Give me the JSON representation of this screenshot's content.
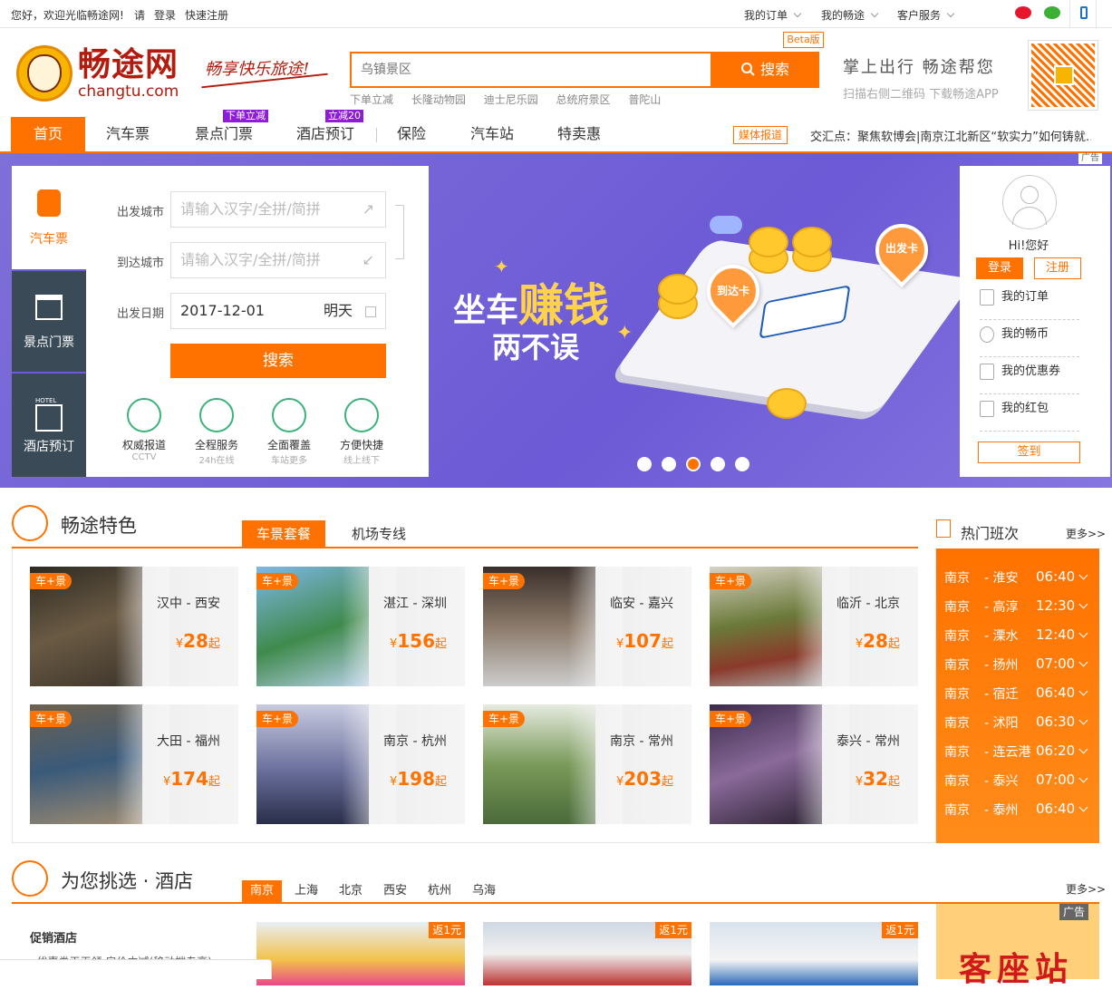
{
  "topbar": {
    "greeting": "您好，欢迎光临畅途网!",
    "please": "请",
    "login": "登录",
    "register": "快速注册",
    "my_orders": "我的订单",
    "my_changtu": "我的畅途",
    "service": "客户服务"
  },
  "header": {
    "logo_cn": "畅途网",
    "logo_en": "changtu.com",
    "slogan": "畅享快乐旅途!",
    "search_placeholder": "乌镇景区",
    "search_button": "搜索",
    "beta": "Beta版",
    "hot_words": [
      "下单立减",
      "长隆动物园",
      "迪士尼乐园",
      "总统府景区",
      "普陀山"
    ],
    "app_slogan": "掌上出行 畅途帮您",
    "app_hint": "扫描右侧二维码 下载畅途APP"
  },
  "nav": {
    "items": [
      "首页",
      "汽车票",
      "景点门票",
      "酒店预订",
      "保险",
      "汽车站",
      "特卖惠"
    ],
    "badge_scenic": "下单立减",
    "badge_hotel": "立减20",
    "media_tag": "媒体报道",
    "media_text": "交汇点：聚焦软博会|南京江北新区“软实力”如何铸就…"
  },
  "banner": {
    "ad": "广告",
    "headline_a": "坐车",
    "headline_b": "赚钱",
    "headline_c": "两不误",
    "pin_arrive": "到达卡",
    "pin_depart": "出发卡",
    "active_slide": 3,
    "slides": 5
  },
  "booking": {
    "tabs": [
      "汽车票",
      "景点门票",
      "酒店预订"
    ],
    "hotel_small": "HOTEL",
    "from_label": "出发城市",
    "to_label": "到达城市",
    "date_label": "出发日期",
    "city_placeholder": "请输入汉字/全拼/简拼",
    "date_value": "2017-12-01",
    "date_hint": "明天",
    "search": "搜索",
    "features": [
      {
        "title": "权威报道",
        "sub": "CCTV"
      },
      {
        "title": "全程服务",
        "sub": "24h在线"
      },
      {
        "title": "全面覆盖",
        "sub": "车站更多"
      },
      {
        "title": "方便快捷",
        "sub": "线上线下"
      }
    ]
  },
  "user": {
    "hi": "Hi!您好",
    "login": "登录",
    "register": "注册",
    "menu": [
      "我的订单",
      "我的畅币",
      "我的优惠券",
      "我的红包"
    ],
    "signin": "签到"
  },
  "feature_section": {
    "title": "畅途特色",
    "tabs": [
      "车景套餐",
      "机场专线"
    ],
    "cards": [
      {
        "tag": "车+景",
        "route": "汉中 - 西安",
        "price": "28",
        "unit": "起"
      },
      {
        "tag": "车+景",
        "route": "湛江 - 深圳",
        "price": "156",
        "unit": "起"
      },
      {
        "tag": "车+景",
        "route": "临安 - 嘉兴",
        "price": "107",
        "unit": "起"
      },
      {
        "tag": "车+景",
        "route": "临沂 - 北京",
        "price": "28",
        "unit": "起"
      },
      {
        "tag": "车+景",
        "route": "大田 - 福州",
        "price": "174",
        "unit": "起"
      },
      {
        "tag": "车+景",
        "route": "南京 - 杭州",
        "price": "198",
        "unit": "起"
      },
      {
        "tag": "车+景",
        "route": "南京 - 常州",
        "price": "203",
        "unit": "起"
      },
      {
        "tag": "车+景",
        "route": "泰兴 - 常州",
        "price": "32",
        "unit": "起"
      }
    ],
    "currency": "¥"
  },
  "hot_routes": {
    "title": "热门班次",
    "more": "更多>>",
    "rows": [
      {
        "from": "南京",
        "to": "- 淮安",
        "time": "06:40"
      },
      {
        "from": "南京",
        "to": "- 高淳",
        "time": "12:30"
      },
      {
        "from": "南京",
        "to": "- 溧水",
        "time": "12:40"
      },
      {
        "from": "南京",
        "to": "- 扬州",
        "time": "07:00"
      },
      {
        "from": "南京",
        "to": "- 宿迁",
        "time": "06:40"
      },
      {
        "from": "南京",
        "to": "- 沭阳",
        "time": "06:30"
      },
      {
        "from": "南京",
        "to": "- 连云港",
        "time": "06:20"
      },
      {
        "from": "南京",
        "to": "- 泰兴",
        "time": "07:00"
      },
      {
        "from": "南京",
        "to": "- 泰州",
        "time": "06:40"
      }
    ]
  },
  "hotel_section": {
    "title": "为您挑选 · 酒店",
    "cities": [
      "南京",
      "上海",
      "北京",
      "西安",
      "杭州",
      "乌海"
    ],
    "more": "更多>>",
    "promo_title": "促销酒店",
    "promo_item": "· 优惠券天天领 房价立减(移动端专享)",
    "badge": "返1元",
    "ad": "广告",
    "ad_text": "客座站"
  },
  "colors": {
    "accent": "#ff7200",
    "banner": "#6c5ad6",
    "dark_tab": "#3a4a57"
  }
}
